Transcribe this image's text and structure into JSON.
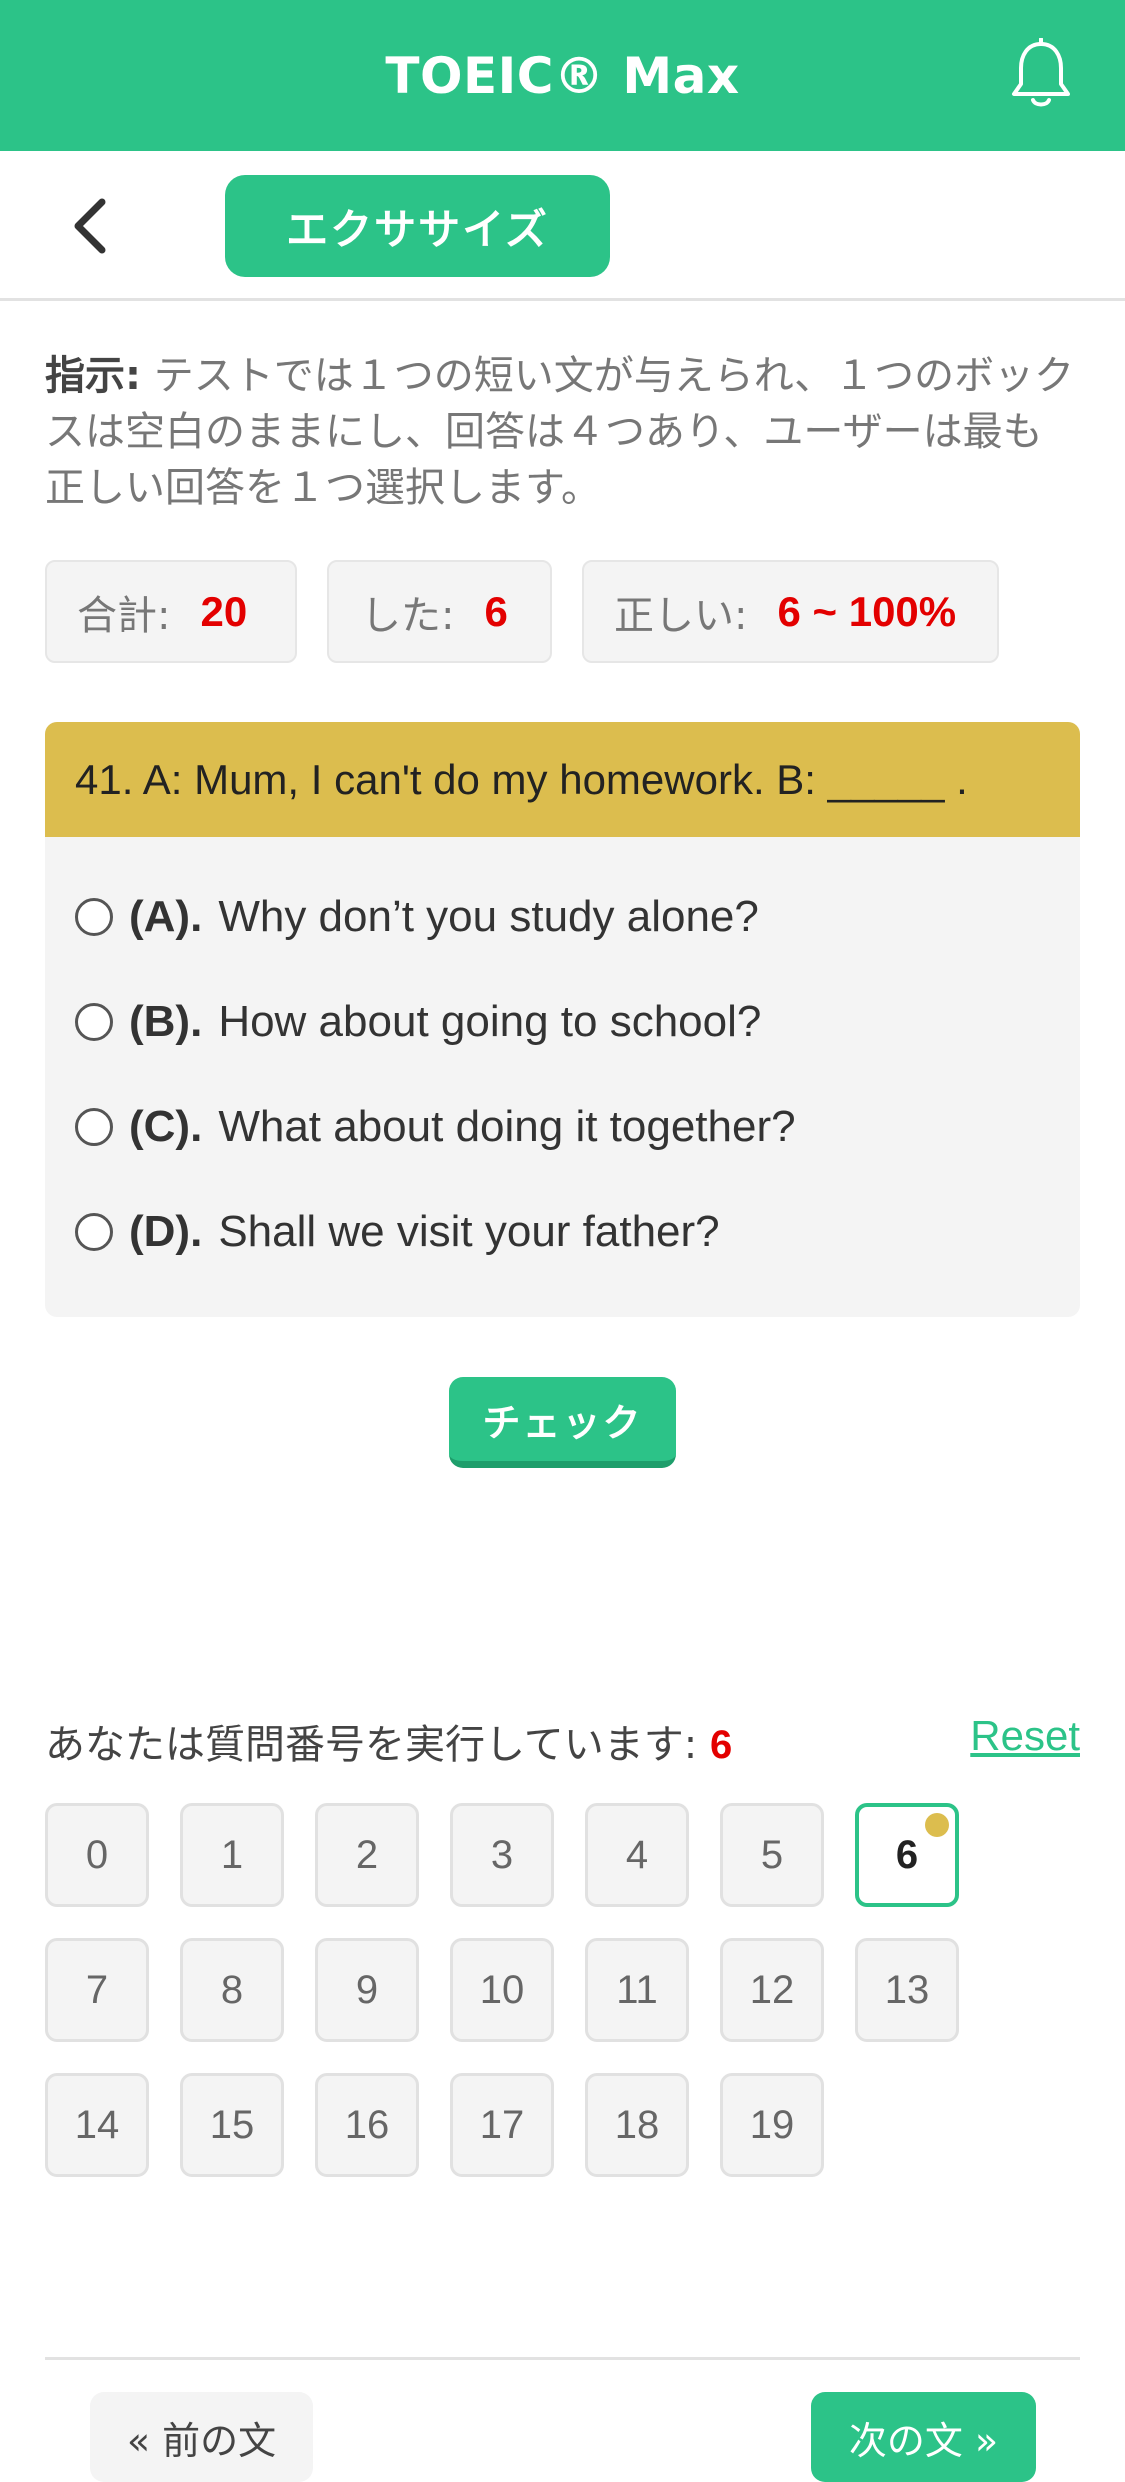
{
  "header": {
    "title": "TOEIC® Max",
    "notification_icon": "bell-icon",
    "bg_color": "#2cc388"
  },
  "subbar": {
    "back_icon": "chevron-left-icon",
    "exercise_label": "エクササイズ"
  },
  "instructions": {
    "label": "指示:",
    "text": " テストでは１つの短い文が与えられ、１つのボックスは空白のままにし、回答は４つあり、ユーザーは最も正しい回答を１つ選択します。"
  },
  "stats": {
    "total_label": "合計:",
    "total_value": "20",
    "done_label": "した:",
    "done_value": "6",
    "correct_label": "正しい:",
    "correct_value": "6 ~ 100%"
  },
  "question": {
    "text": "41. A: Mum, I can't do my homework. B: _____ .",
    "options": [
      {
        "letter": "(A).",
        "text": "Why don’t you study alone?"
      },
      {
        "letter": "(B).",
        "text": "How about going to school?"
      },
      {
        "letter": "(C).",
        "text": "What about doing it together?"
      },
      {
        "letter": "(D).",
        "text": "Shall we visit your father?"
      }
    ]
  },
  "check_label": "チェック",
  "progress": {
    "label": "あなたは質問番号を実行しています:",
    "current": "6",
    "reset_label": "Reset",
    "numbers": [
      "0",
      "1",
      "2",
      "3",
      "4",
      "5",
      "6",
      "7",
      "8",
      "9",
      "10",
      "11",
      "12",
      "13",
      "14",
      "15",
      "16",
      "17",
      "18",
      "19"
    ]
  },
  "footer": {
    "prev_label": "« 前の文",
    "next_label": "次の文 »"
  },
  "colors": {
    "accent": "#2cc388",
    "question_bar": "#dcbd4e",
    "value_red": "#e30000"
  }
}
